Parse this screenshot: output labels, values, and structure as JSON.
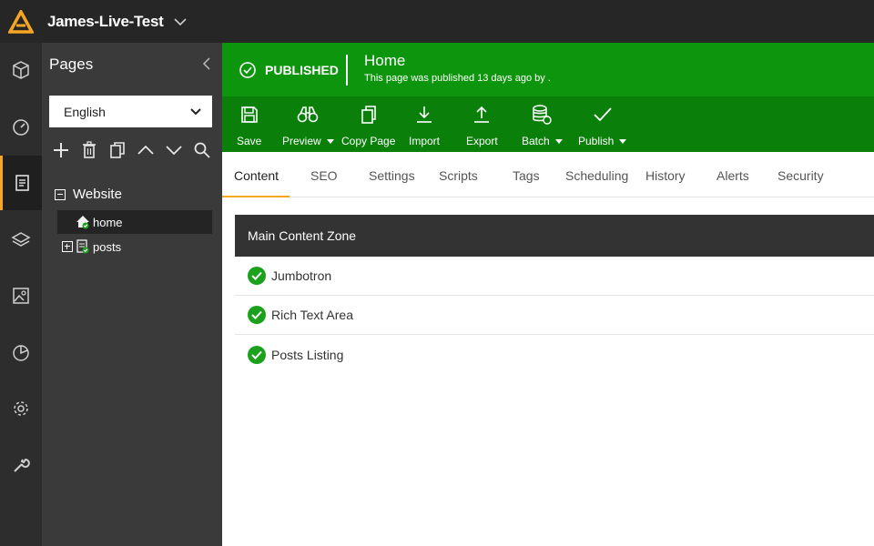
{
  "app": {
    "site_name": "James-Live-Test",
    "accent": "#f5a623"
  },
  "rail": {
    "items": [
      {
        "icon": "cube-icon"
      },
      {
        "icon": "dashboard-gauge-icon"
      },
      {
        "icon": "pages-icon"
      },
      {
        "icon": "layers-icon"
      },
      {
        "icon": "image-icon"
      },
      {
        "icon": "pie-chart-icon"
      },
      {
        "icon": "gear-icon"
      },
      {
        "icon": "wrench-icon"
      }
    ]
  },
  "pages_panel": {
    "title": "Pages",
    "language": "English",
    "tools": [
      "plus-icon",
      "trash-icon",
      "copy-icon",
      "chevron-up-icon",
      "chevron-down-icon",
      "search-icon"
    ],
    "tree": {
      "root": "Website",
      "nodes": [
        {
          "label": "home",
          "icon": "home-published-icon"
        },
        {
          "label": "posts",
          "icon": "page-published-icon"
        }
      ]
    }
  },
  "status": {
    "label": "PUBLISHED",
    "page_title": "Home",
    "subtitle": "This page was published 13 days ago by .",
    "color": "#0d960d"
  },
  "toolbar": {
    "save": "Save",
    "preview": "Preview",
    "copy_page": "Copy Page",
    "import": "Import",
    "export": "Export",
    "batch": "Batch",
    "publish": "Publish"
  },
  "tabs": [
    "Content",
    "SEO",
    "Settings",
    "Scripts",
    "Tags",
    "Scheduling",
    "History",
    "Alerts",
    "Security"
  ],
  "content_zone": {
    "title": "Main Content Zone",
    "items": [
      "Jumbotron",
      "Rich Text Area",
      "Posts Listing"
    ]
  }
}
